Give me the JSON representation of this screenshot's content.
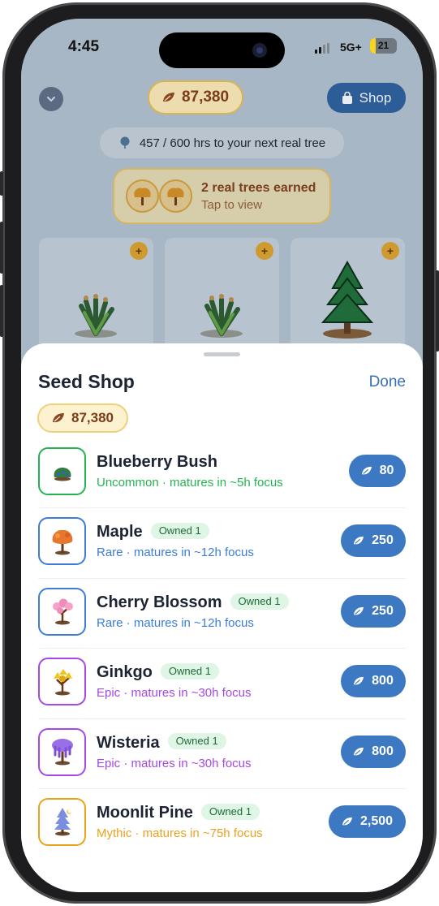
{
  "status": {
    "time": "4:45",
    "network": "5G+",
    "battery": "21"
  },
  "header": {
    "balance": "87,380",
    "shop_label": "Shop"
  },
  "progress_text": "457 / 600 hrs to your next real tree",
  "earned": {
    "title": "2 real trees earned",
    "subtitle": "Tap to view"
  },
  "sheet": {
    "title": "Seed Shop",
    "done_label": "Done",
    "balance": "87,380",
    "items": [
      {
        "name": "Blueberry Bush",
        "owned": "",
        "rarity": "Uncommon",
        "sub": "Uncommon · matures in ~5h focus",
        "price": "80",
        "color": "#22b450",
        "icon": "blueberry-bush-icon"
      },
      {
        "name": "Maple",
        "owned": "Owned 1",
        "rarity": "Rare",
        "sub": "Rare · matures in ~12h focus",
        "price": "250",
        "color": "#3b7dd8",
        "icon": "maple-tree-icon"
      },
      {
        "name": "Cherry Blossom",
        "owned": "Owned 1",
        "rarity": "Rare",
        "sub": "Rare · matures in ~12h focus",
        "price": "250",
        "color": "#3b7dd8",
        "icon": "cherry-blossom-icon"
      },
      {
        "name": "Ginkgo",
        "owned": "Owned 1",
        "rarity": "Epic",
        "sub": "Epic · matures in ~30h focus",
        "price": "800",
        "color": "#a548e6",
        "icon": "ginkgo-tree-icon"
      },
      {
        "name": "Wisteria",
        "owned": "Owned 1",
        "rarity": "Epic",
        "sub": "Epic · matures in ~30h focus",
        "price": "800",
        "color": "#a548e6",
        "icon": "wisteria-tree-icon"
      },
      {
        "name": "Moonlit Pine",
        "owned": "Owned 1",
        "rarity": "Mythic",
        "sub": "Mythic · matures in ~75h focus",
        "price": "2,500",
        "color": "#eba21b",
        "icon": "moonlit-pine-icon"
      }
    ]
  }
}
